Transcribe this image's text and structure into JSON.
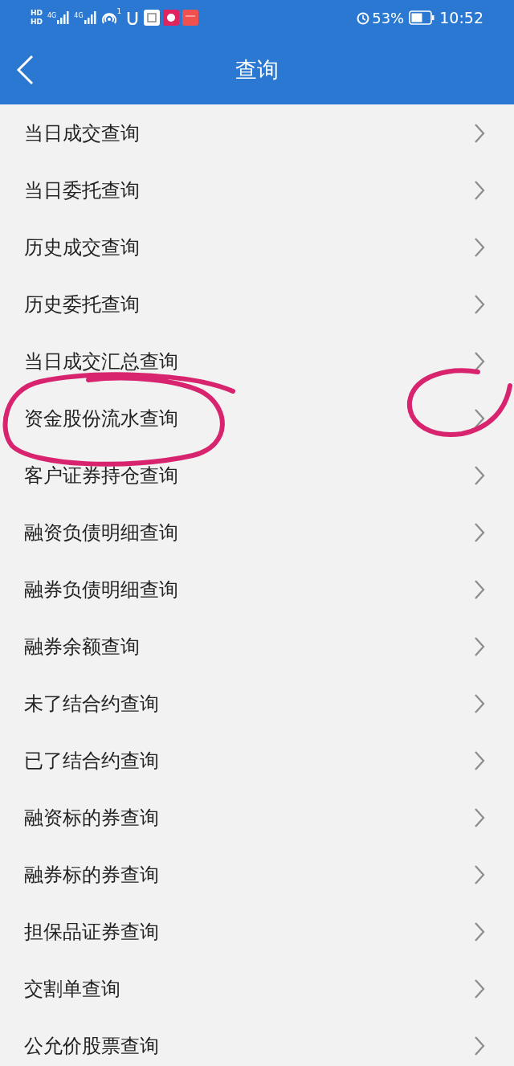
{
  "status_bar": {
    "sim_labels": [
      "HD",
      "HD"
    ],
    "network_labels": [
      "4G",
      "4G"
    ],
    "hotspot_count": "1",
    "battery_percent": "53%",
    "time": "10:52"
  },
  "header": {
    "title": "查询"
  },
  "menu_items": [
    {
      "label": "当日成交查询"
    },
    {
      "label": "当日委托查询"
    },
    {
      "label": "历史成交查询"
    },
    {
      "label": "历史委托查询"
    },
    {
      "label": "当日成交汇总查询"
    },
    {
      "label": "资金股份流水查询",
      "circled": true
    },
    {
      "label": "客户证券持仓查询"
    },
    {
      "label": "融资负债明细查询"
    },
    {
      "label": "融券负债明细查询"
    },
    {
      "label": "融券余额查询"
    },
    {
      "label": "未了结合约查询"
    },
    {
      "label": "已了结合约查询"
    },
    {
      "label": "融资标的券查询"
    },
    {
      "label": "融券标的券查询"
    },
    {
      "label": "担保品证券查询"
    },
    {
      "label": "交割单查询"
    },
    {
      "label": "公允价股票查询"
    }
  ]
}
